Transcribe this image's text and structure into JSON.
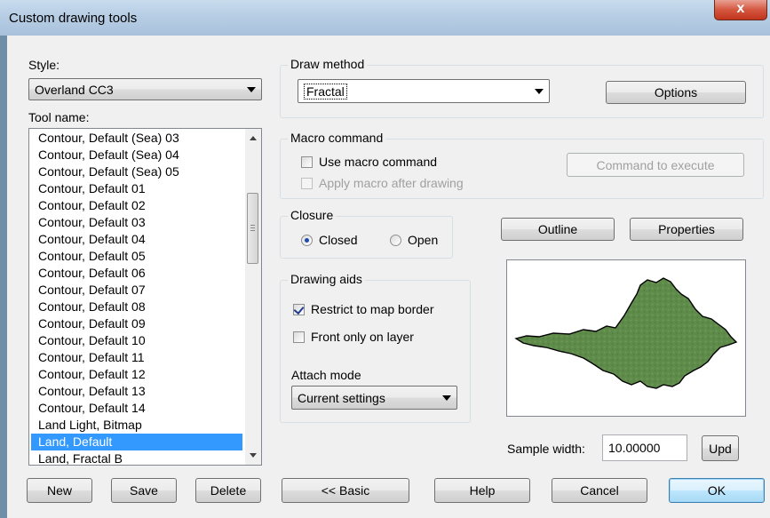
{
  "window": {
    "title": "Custom drawing tools",
    "close_glyph": "x"
  },
  "style": {
    "label": "Style:",
    "selected": "Overland CC3"
  },
  "tool_name": {
    "label": "Tool name:",
    "items": [
      "Contour, Default (Sea) 03",
      "Contour, Default (Sea) 04",
      "Contour, Default (Sea) 05",
      "Contour, Default 01",
      "Contour, Default 02",
      "Contour, Default 03",
      "Contour, Default 04",
      "Contour, Default 05",
      "Contour, Default 06",
      "Contour, Default 07",
      "Contour, Default 08",
      "Contour, Default 09",
      "Contour, Default 10",
      "Contour, Default 11",
      "Contour, Default 12",
      "Contour, Default 13",
      "Contour, Default 14",
      "Land Light, Bitmap",
      "Land, Default",
      "Land, Fractal B"
    ],
    "selected_index": 18
  },
  "draw_method": {
    "legend": "Draw method",
    "selected": "Fractal",
    "options_button": "Options"
  },
  "macro": {
    "legend": "Macro command",
    "use_macro": {
      "label": "Use macro command",
      "checked": false
    },
    "apply_after": {
      "label": "Apply macro after drawing",
      "checked": false,
      "enabled": false
    },
    "command_button": "Command to execute"
  },
  "closure": {
    "legend": "Closure",
    "closed_label": "Closed",
    "open_label": "Open",
    "selected": "Closed"
  },
  "drawing_aids": {
    "legend": "Drawing aids",
    "restrict": {
      "label": "Restrict to map border",
      "checked": true
    },
    "front_only": {
      "label": "Front only on layer",
      "checked": false
    },
    "attach_label": "Attach mode",
    "attach_selected": "Current settings"
  },
  "preview": {
    "outline_button": "Outline",
    "properties_button": "Properties",
    "fill_color": "#5e8a4a"
  },
  "sample": {
    "label": "Sample width:",
    "value": "10.00000",
    "upd_button": "Upd"
  },
  "bottom_buttons": {
    "new": "New",
    "save": "Save",
    "delete": "Delete",
    "basic": "<< Basic",
    "help": "Help",
    "cancel": "Cancel",
    "ok": "OK"
  }
}
